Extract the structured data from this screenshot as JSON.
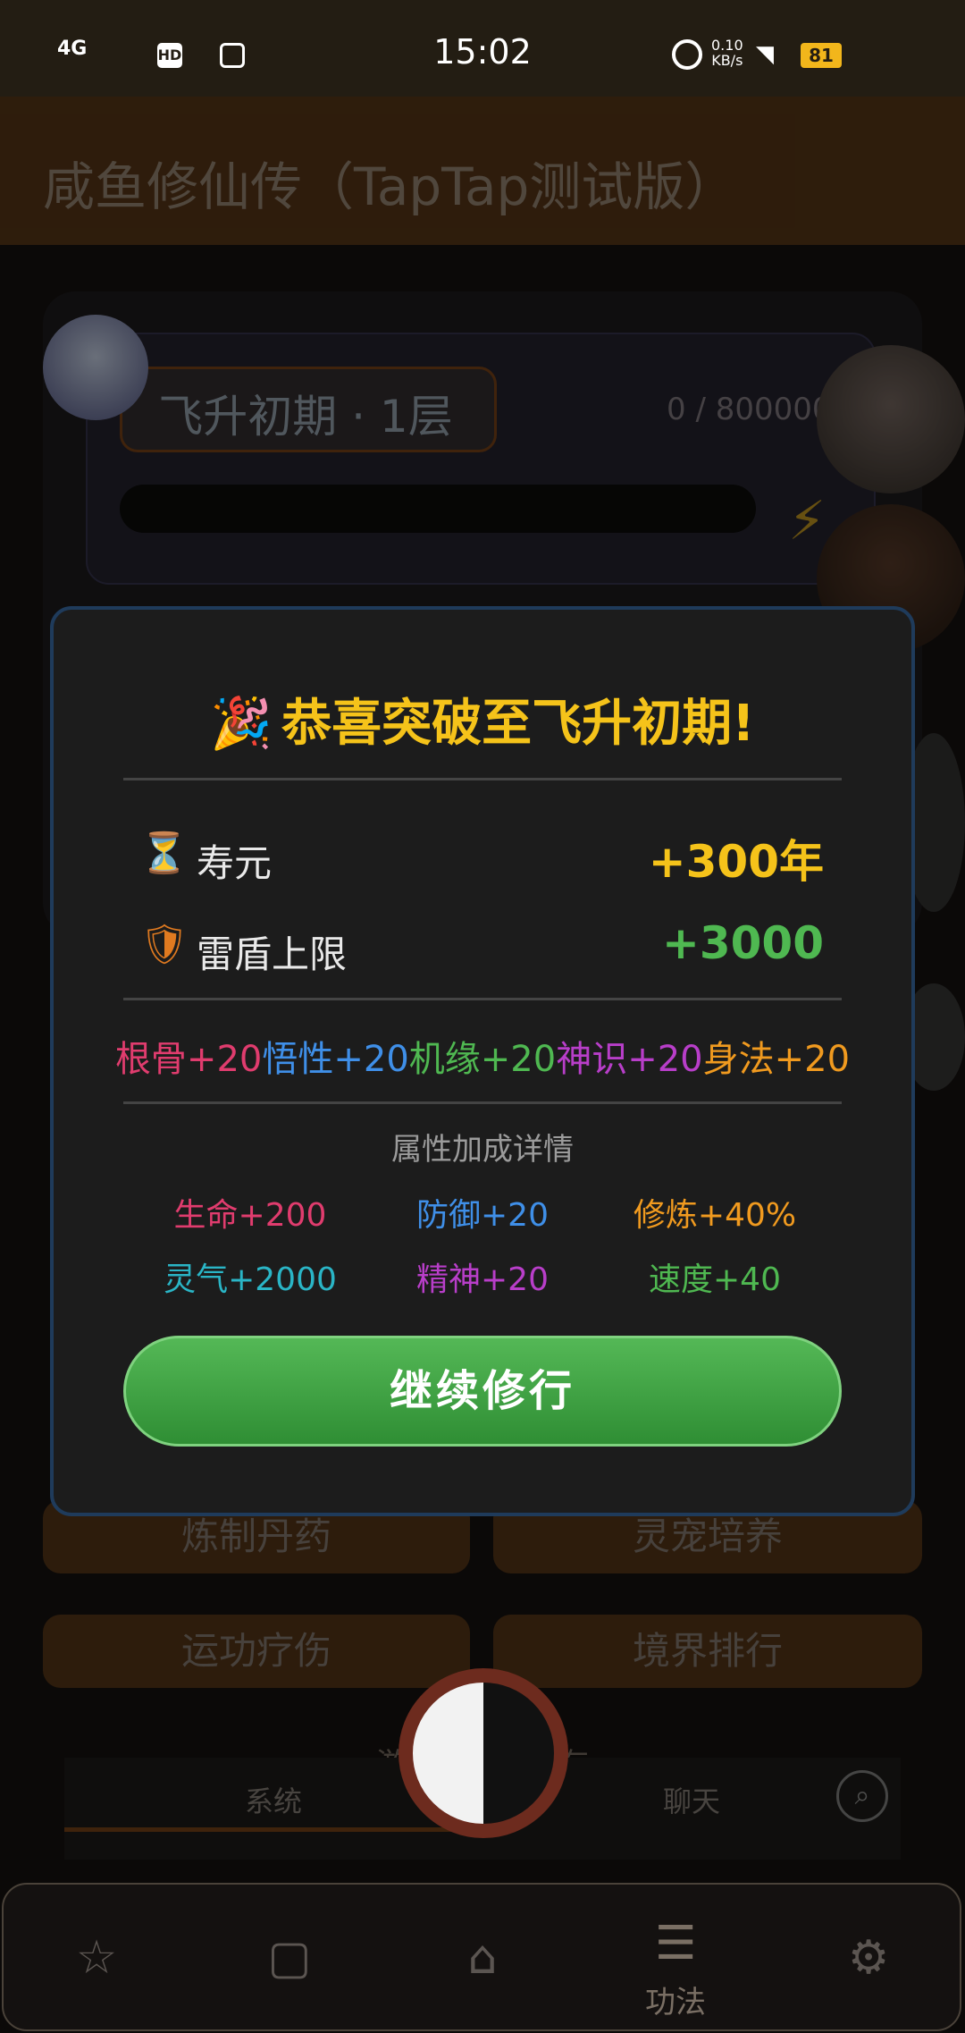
{
  "status_bar": {
    "signal": "4G",
    "time": "15:02",
    "net_speed": "0.10\nKB/s",
    "battery": "81"
  },
  "header": {
    "title": "咸鱼修仙传（TapTap测试版）"
  },
  "realm": {
    "level": "飞升初期 · 1层",
    "exp": "0 / 800000"
  },
  "actions": {
    "pill": "炼制丹药",
    "pet": "灵宠培养",
    "heal": "运功疗伤",
    "rank": "境界排行"
  },
  "log": {
    "autosave": "游戏已自动保存",
    "tab_system": "系统",
    "tab_chat": "聊天"
  },
  "nav": {
    "active_label": "功法"
  },
  "dialog": {
    "title_icon": "🎉",
    "title": "恭喜突破至飞升初期!",
    "lifespan_icon": "⏳",
    "lifespan_label": "寿元",
    "lifespan_value": "+300年",
    "shield_icon": "🛡",
    "shield_label": "雷盾上限",
    "shield_value": "+3000",
    "attributes": [
      {
        "text": "根骨+20",
        "color": "#e03c6e"
      },
      {
        "text": "悟性+20",
        "color": "#3f8fe8"
      },
      {
        "text": "机缘+20",
        "color": "#4fb851"
      },
      {
        "text": "神识+20",
        "color": "#b83ec9"
      },
      {
        "text": "身法+20",
        "color": "#f09a1f"
      }
    ],
    "bonus_title": "属性加成详情",
    "bonuses": {
      "hp": "生命+200",
      "defense": "防御+20",
      "cultivation": "修炼+40%",
      "qi": "灵气+2000",
      "spirit": "精神+20",
      "speed": "速度+40"
    },
    "continue_label": "继续修行"
  }
}
